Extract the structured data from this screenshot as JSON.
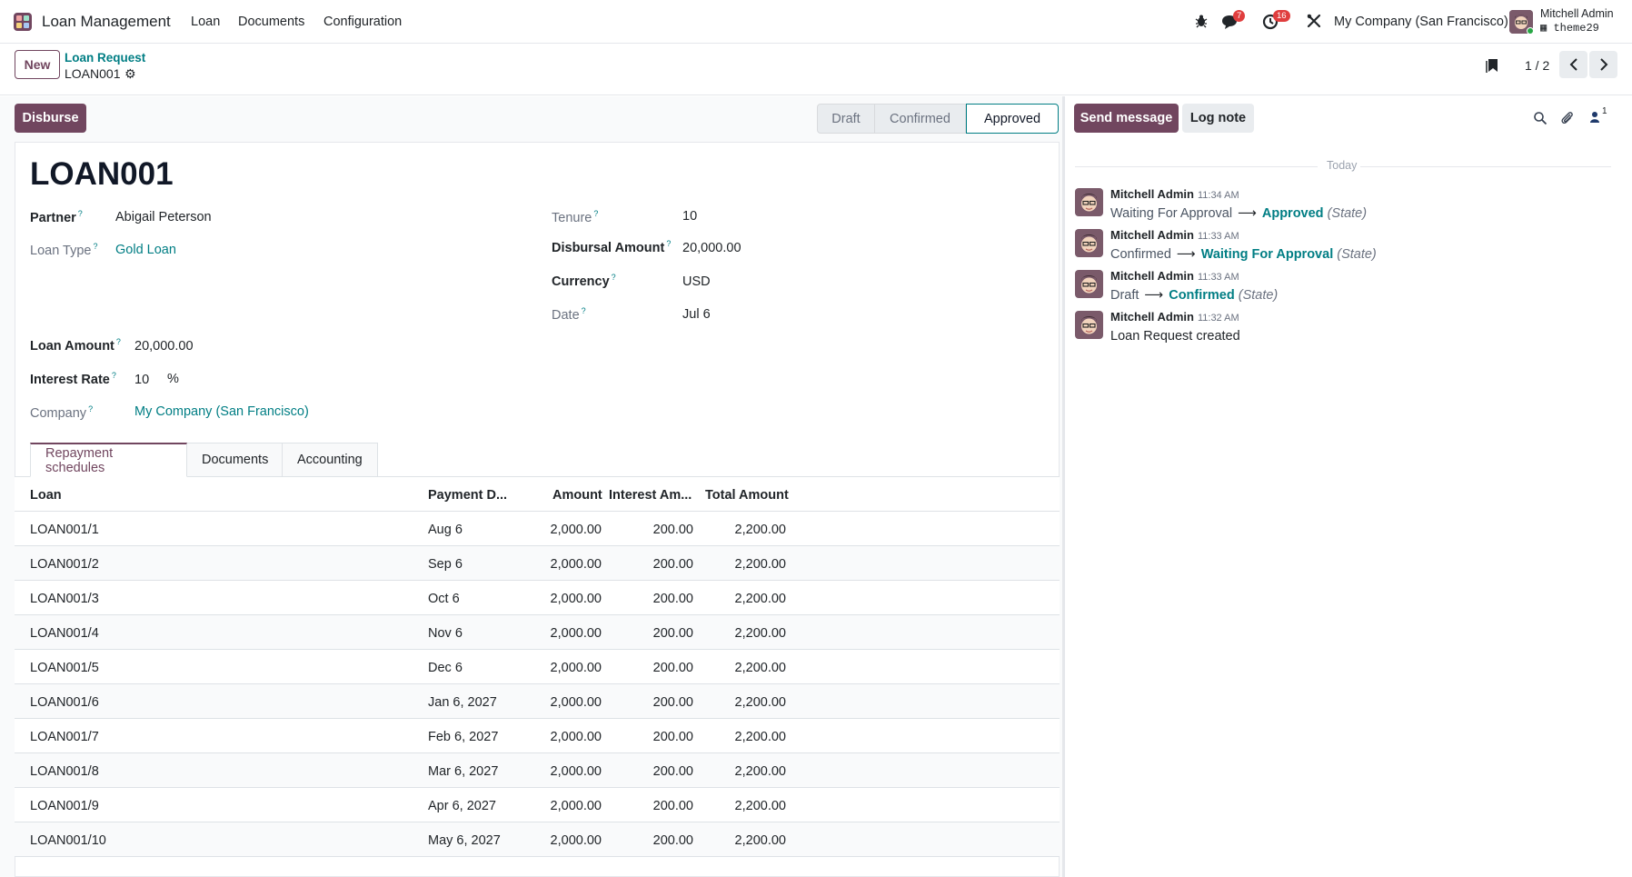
{
  "app": {
    "name": "Loan Management",
    "menus": [
      "Loan",
      "Documents",
      "Configuration"
    ]
  },
  "systray": {
    "messages_count": "7",
    "activities_count": "16",
    "company": "My Company (San Francisco)",
    "user_name": "Mitchell Admin",
    "user_db": "theme29"
  },
  "control": {
    "new_label": "New",
    "breadcrumb_parent": "Loan Request",
    "breadcrumb_current": "LOAN001",
    "pager": "1 / 2"
  },
  "actions": {
    "disburse": "Disburse"
  },
  "statusbar": {
    "stages": [
      "Draft",
      "Confirmed",
      "Approved"
    ],
    "active": "Approved"
  },
  "record": {
    "title": "LOAN001",
    "fields": {
      "partner": {
        "label": "Partner",
        "value": "Abigail Peterson"
      },
      "loan_type": {
        "label": "Loan Type",
        "value": "Gold Loan"
      },
      "loan_amount": {
        "label": "Loan Amount",
        "value": "20,000.00"
      },
      "interest_rate": {
        "label": "Interest Rate",
        "value": "10",
        "unit": "%"
      },
      "company": {
        "label": "Company",
        "value": "My Company (San Francisco)"
      },
      "tenure": {
        "label": "Tenure",
        "value": "10"
      },
      "disbursal_amount": {
        "label": "Disbursal Amount",
        "value": "20,000.00"
      },
      "currency": {
        "label": "Currency",
        "value": "USD"
      },
      "date": {
        "label": "Date",
        "value": "Jul 6"
      }
    },
    "help_mark": "?"
  },
  "tabs": [
    "Repayment schedules",
    "Documents",
    "Accounting"
  ],
  "schedule": {
    "columns": {
      "loan": "Loan",
      "payment_date": "Payment D...",
      "amount": "Amount",
      "interest": "Interest Am...",
      "total": "Total Amount"
    },
    "rows": [
      {
        "loan": "LOAN001/1",
        "date": "Aug 6",
        "amount": "2,000.00",
        "interest": "200.00",
        "total": "2,200.00"
      },
      {
        "loan": "LOAN001/2",
        "date": "Sep 6",
        "amount": "2,000.00",
        "interest": "200.00",
        "total": "2,200.00"
      },
      {
        "loan": "LOAN001/3",
        "date": "Oct 6",
        "amount": "2,000.00",
        "interest": "200.00",
        "total": "2,200.00"
      },
      {
        "loan": "LOAN001/4",
        "date": "Nov 6",
        "amount": "2,000.00",
        "interest": "200.00",
        "total": "2,200.00"
      },
      {
        "loan": "LOAN001/5",
        "date": "Dec 6",
        "amount": "2,000.00",
        "interest": "200.00",
        "total": "2,200.00"
      },
      {
        "loan": "LOAN001/6",
        "date": "Jan 6, 2027",
        "amount": "2,000.00",
        "interest": "200.00",
        "total": "2,200.00"
      },
      {
        "loan": "LOAN001/7",
        "date": "Feb 6, 2027",
        "amount": "2,000.00",
        "interest": "200.00",
        "total": "2,200.00"
      },
      {
        "loan": "LOAN001/8",
        "date": "Mar 6, 2027",
        "amount": "2,000.00",
        "interest": "200.00",
        "total": "2,200.00"
      },
      {
        "loan": "LOAN001/9",
        "date": "Apr 6, 2027",
        "amount": "2,000.00",
        "interest": "200.00",
        "total": "2,200.00"
      },
      {
        "loan": "LOAN001/10",
        "date": "May 6, 2027",
        "amount": "2,000.00",
        "interest": "200.00",
        "total": "2,200.00"
      }
    ]
  },
  "chatter": {
    "send_message": "Send message",
    "log_note": "Log note",
    "followers_count": "1",
    "separator": "Today",
    "messages": [
      {
        "author": "Mitchell Admin",
        "time": "11:34 AM",
        "from": "Waiting For Approval",
        "to": "Approved",
        "field": "(State)"
      },
      {
        "author": "Mitchell Admin",
        "time": "11:33 AM",
        "from": "Confirmed",
        "to": "Waiting For Approval",
        "field": "(State)"
      },
      {
        "author": "Mitchell Admin",
        "time": "11:33 AM",
        "from": "Draft",
        "to": "Confirmed",
        "field": "(State)"
      },
      {
        "author": "Mitchell Admin",
        "time": "11:32 AM",
        "text": "Loan Request created"
      }
    ],
    "arrow": "⟶"
  },
  "colors": {
    "brand": "#71465f",
    "link": "#017e84",
    "badge": "#e03e3e"
  }
}
